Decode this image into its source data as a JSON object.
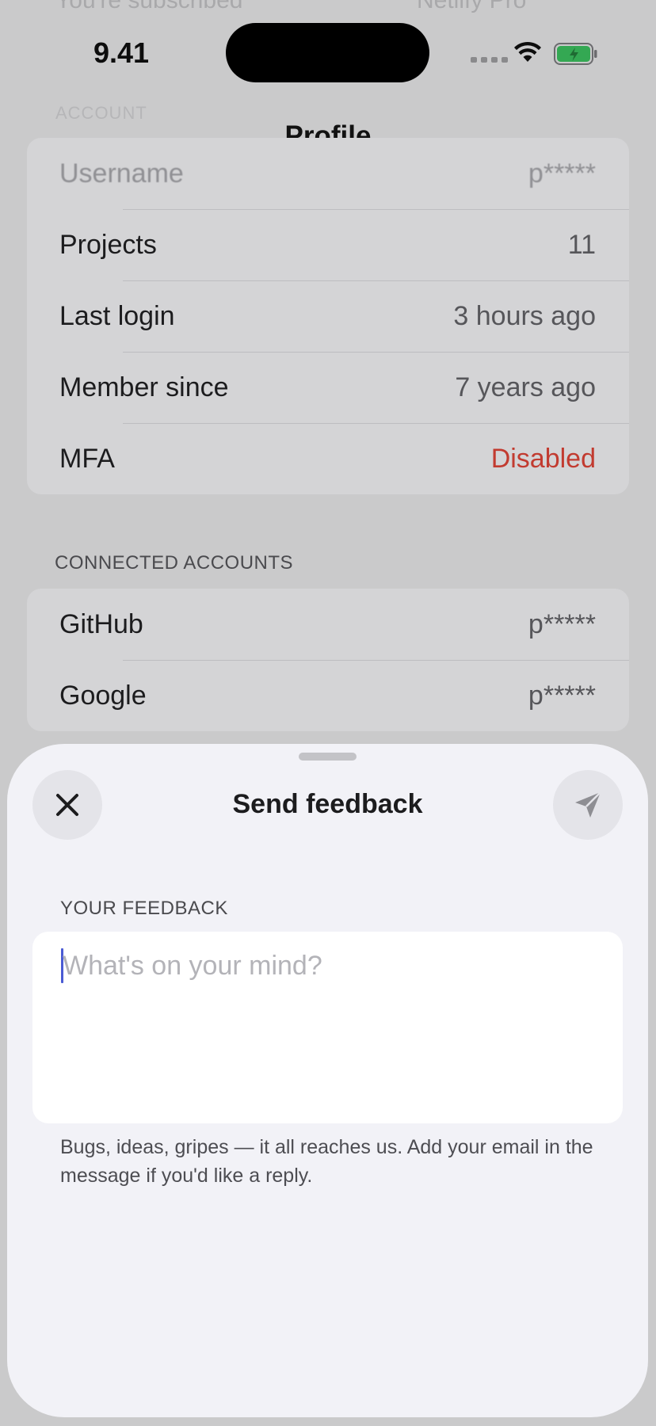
{
  "status_bar": {
    "time": "9.41",
    "signal_icon": "cellular-signal-icon",
    "wifi_icon": "wifi-icon",
    "battery_icon": "battery-charging-icon",
    "battery_color": "#34a853"
  },
  "background_screen": {
    "partial_top_left": "You're subscribed",
    "partial_top_right": "Netlify Pro",
    "section_account": "ACCOUNT",
    "nav_title": "Profile",
    "account_rows": [
      {
        "label": "Username",
        "value": "p*****"
      },
      {
        "label": "Projects",
        "value": "11"
      },
      {
        "label": "Last login",
        "value": "3 hours ago"
      },
      {
        "label": "Member since",
        "value": "7 years ago"
      },
      {
        "label": "MFA",
        "value": "Disabled"
      }
    ],
    "section_connected": "CONNECTED ACCOUNTS",
    "connected_rows": [
      {
        "label": "GitHub",
        "value": "p*****"
      },
      {
        "label": "Google",
        "value": "p*****"
      }
    ],
    "danger_color": "#c23b30"
  },
  "sheet": {
    "title": "Send feedback",
    "close_icon": "close-icon",
    "send_icon": "send-icon",
    "feedback_label": "YOUR FEEDBACK",
    "feedback_value": "",
    "feedback_placeholder": "What's on your mind?",
    "help_text": "Bugs, ideas, gripes — it all reaches us. Add your email in the message if you'd like a reply."
  }
}
